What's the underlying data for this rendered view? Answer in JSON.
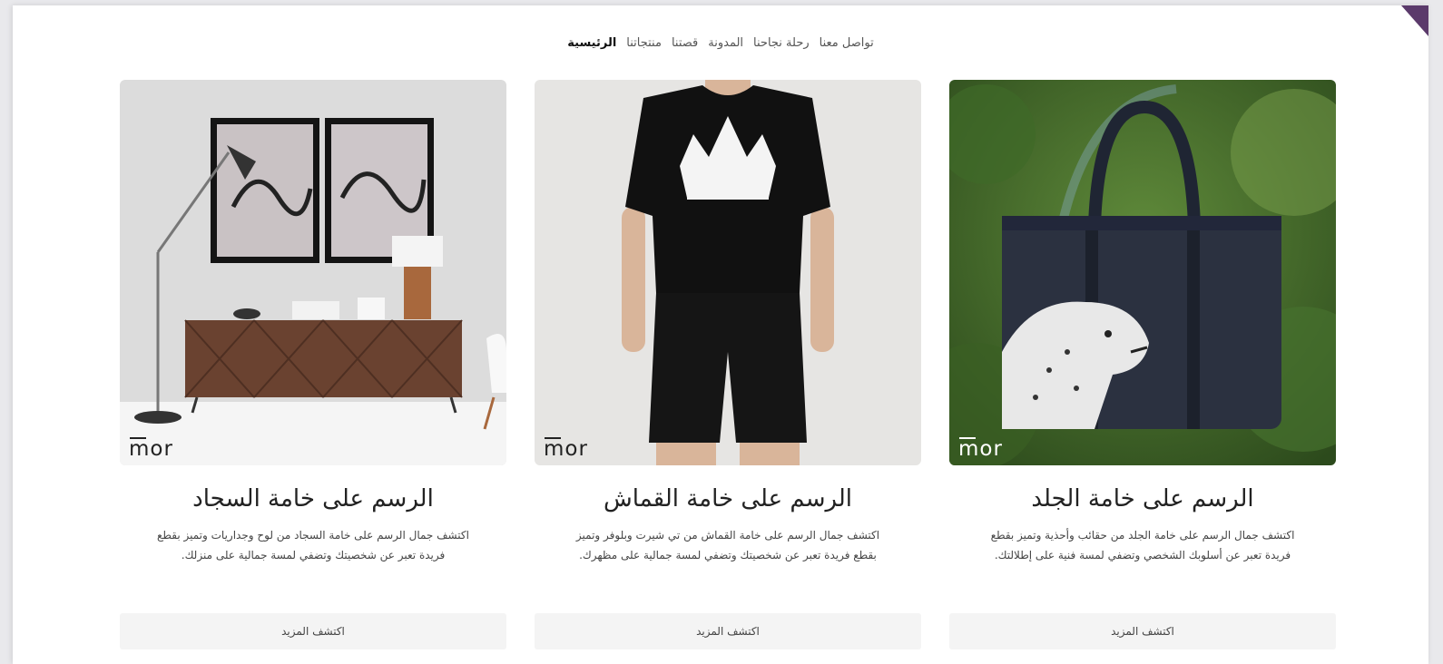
{
  "nav": {
    "items": [
      {
        "label": "الرئيسية",
        "active": true
      },
      {
        "label": "منتجاتنا",
        "active": false
      },
      {
        "label": "قصتنا",
        "active": false
      },
      {
        "label": "المدونة",
        "active": false
      },
      {
        "label": "رحلة نجاحنا",
        "active": false
      },
      {
        "label": "تواصل معنا",
        "active": false
      }
    ]
  },
  "brand": {
    "logo_text": "mor",
    "accent": "#5b3a6b"
  },
  "cards": [
    {
      "title": "الرسم على خامة الجلد",
      "description": "اكتشف جمال الرسم على خامة الجلد من حقائب وأحذية وتميز بقطع فريدة تعبر عن أسلوبك الشخصي وتضفي لمسة فنية على إطلالتك.",
      "button": "اكتشف المزيد",
      "image_icon": "leather-bag-image"
    },
    {
      "title": "الرسم على خامة القماش",
      "description": "اكتشف جمال الرسم على خامة القماش من تي شيرت وبلوفر وتميز بقطع فريدة تعبر عن شخصيتك وتضفي لمسة جمالية على مظهرك.",
      "button": "اكتشف المزيد",
      "image_icon": "tshirt-image"
    },
    {
      "title": "الرسم على خامة السجاد",
      "description": "اكتشف جمال الرسم على خامة السجاد من لوح وجداريات وتميز بقطع فريدة تعبر عن شخصيتك وتضفي لمسة جمالية على منزلك.",
      "button": "اكتشف المزيد",
      "image_icon": "wall-art-image"
    }
  ]
}
